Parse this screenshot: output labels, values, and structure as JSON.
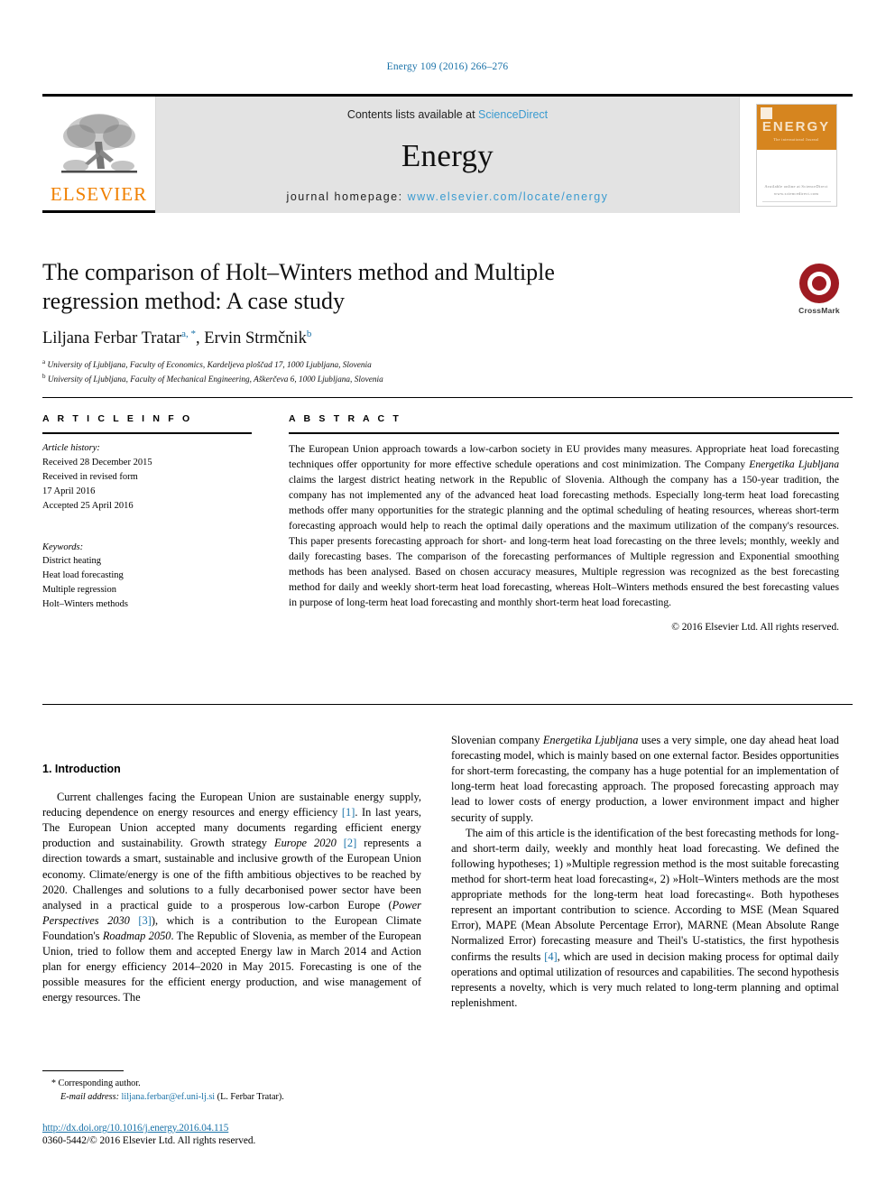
{
  "running_head": "Energy 109 (2016) 266–276",
  "masthead": {
    "publisher_logo_name": "elsevier-tree-logo",
    "publisher_word": "ELSEVIER",
    "contents_prefix": "Contents lists available at ",
    "contents_link": "ScienceDirect",
    "journal_name": "Energy",
    "homepage_prefix": "journal homepage: ",
    "homepage_url": "www.elsevier.com/locate/energy",
    "cover": {
      "title": "ENERGY",
      "subtitle": "The international Journal",
      "footer": "Available online at\nScienceDirect\nwww.sciencedirect.com"
    }
  },
  "article": {
    "title": "The comparison of Holt–Winters method and Multiple regression method: A case study",
    "authors": "Liljana Ferbar Tratar , Ervin Strmčnik",
    "author1": "Liljana Ferbar Tratar",
    "author1_marks": "a, *",
    "author2": "Ervin Strmčnik",
    "author2_marks": "b",
    "affiliation_a_mark": "a",
    "affiliation_a": "University of Ljubljana, Faculty of Economics, Kardeljeva ploščad 17, 1000 Ljubljana, Slovenia",
    "affiliation_b_mark": "b",
    "affiliation_b": "University of Ljubljana, Faculty of Mechanical Engineering, Aškerčeva 6, 1000 Ljubljana, Slovenia"
  },
  "crossmark": {
    "label": "CrossMark"
  },
  "article_info": {
    "heading": "A R T I C L E  I N F O",
    "history_label": "Article history:",
    "history": [
      "Received 28 December 2015",
      "Received in revised form",
      "17 April 2016",
      "Accepted 25 April 2016"
    ],
    "keywords_label": "Keywords:",
    "keywords": [
      "District heating",
      "Heat load forecasting",
      "Multiple regression",
      "Holt–Winters methods"
    ]
  },
  "abstract": {
    "heading": "A B S T R A C T",
    "part1": "The European Union approach towards a low-carbon society in EU provides many measures. Appropriate heat load forecasting techniques offer opportunity for more effective schedule operations and cost minimization. The Company ",
    "company_italic": "Energetika Ljubljana",
    "part2": " claims the largest district heating network in the Republic of Slovenia. Although the company has a 150-year tradition, the company has not implemented any of the advanced heat load forecasting methods. Especially long-term heat load forecasting methods offer many opportunities for the strategic planning and the optimal scheduling of heating resources, whereas short-term forecasting approach would help to reach the optimal daily operations and the maximum utilization of the company's resources. This paper presents forecasting approach for short- and long-term heat load forecasting on the three levels; monthly, weekly and daily forecasting bases. The comparison of the forecasting performances of Multiple regression and Exponential smoothing methods has been analysed. Based on chosen accuracy measures, Multiple regression was recognized as the best forecasting method for daily and weekly short-term heat load forecasting, whereas Holt–Winters methods ensured the best forecasting values in purpose of long-term heat load forecasting and monthly short-term heat load forecasting.",
    "copyright": "© 2016 Elsevier Ltd. All rights reserved."
  },
  "introduction": {
    "heading": "1. Introduction",
    "left_p1_a": "Current challenges facing the European Union are sustainable energy supply, reducing dependence on energy resources and energy efficiency ",
    "left_p1_ref1": "[1]",
    "left_p1_b": ". In last years, The European Union accepted many documents regarding efficient energy production and sustainability. Growth strategy ",
    "left_p1_italic1": "Europe 2020",
    "left_p1_ref2": "[2]",
    "left_p1_c": " represents a direction towards a smart, sustainable and inclusive growth of the European Union economy. Climate/energy is one of the fifth ambitious objectives to be reached by 2020. Challenges and solutions to a fully decarbonised power sector have been analysed in a practical guide to a prosperous low-carbon Europe (",
    "left_p1_italic2": "Power Perspectives 2030",
    "left_p1_ref3": "[3]",
    "left_p1_d": "), which is a contribution to the European Climate Foundation's ",
    "left_p1_italic3": "Roadmap 2050",
    "left_p1_e": ". The Republic of Slovenia, as member of the European Union, tried to follow them and accepted Energy law in March 2014 and Action plan for energy efficiency 2014–2020 in May 2015. Forecasting is one of the possible measures for the efficient energy production, and wise management of energy resources. The",
    "right_p1_a": "Slovenian company ",
    "right_p1_italic": "Energetika Ljubljana",
    "right_p1_b": " uses a very simple, one day ahead heat load forecasting model, which is mainly based on one external factor. Besides opportunities for short-term forecasting, the company has a huge potential for an implementation of long-term heat load forecasting approach. The proposed forecasting approach may lead to lower costs of energy production, a lower environment impact and higher security of supply.",
    "right_p2_a": "The aim of this article is the identification of the best forecasting methods for long- and short-term daily, weekly and monthly heat load forecasting. We defined the following hypotheses; 1) »Multiple regression method is the most suitable forecasting method for short-term heat load forecasting«, 2) »Holt–Winters methods are the most appropriate methods for the long-term heat load forecasting«. Both hypotheses represent an important contribution to science. According to MSE (Mean Squared Error), MAPE (Mean Absolute Percentage Error), MARNE (Mean Absolute Range Normalized Error) forecasting measure and Theil's U-statistics, the first hypothesis confirms the results ",
    "right_p2_ref": "[4]",
    "right_p2_b": ", which are used in decision making process for optimal daily operations and optimal utilization of resources and capabilities. The second hypothesis represents a novelty, which is very much related to long-term planning and optimal replenishment."
  },
  "footnote": {
    "star": "*",
    "corresponding": " Corresponding author.",
    "email_label": "E-mail address:",
    "email": "liljana.ferbar@ef.uni-lj.si",
    "email_suffix": " (L. Ferbar Tratar)."
  },
  "footer": {
    "doi": "http://dx.doi.org/10.1016/j.energy.2016.04.115",
    "issn": "0360-5442/© 2016 Elsevier Ltd. All rights reserved."
  },
  "colors": {
    "link_blue": "#1a72a8",
    "sciencedirect_blue": "#3a9bd0",
    "elsevier_orange": "#f08000",
    "masthead_grey": "#e3e3e3",
    "crossmark_red": "#9e1b22",
    "cover_orange": "#d6851f"
  }
}
